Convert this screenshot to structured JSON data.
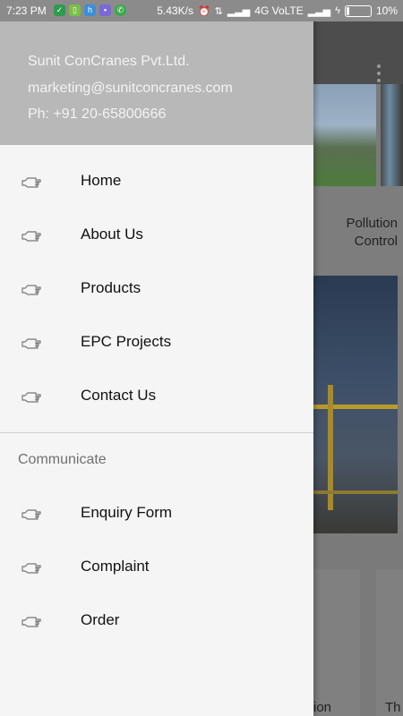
{
  "status_bar": {
    "time": "7:23 PM",
    "speed": "5.43K/s",
    "network": "4G VoLTE",
    "battery": "10%",
    "battery_level": 0.1
  },
  "drawer": {
    "company": "Sunit ConCranes Pvt.Ltd.",
    "email": "marketing@sunitconcranes.com",
    "phone": "Ph: +91 20-65800666",
    "items": [
      {
        "label": "Home",
        "icon": "pointing-hand-icon"
      },
      {
        "label": "About Us",
        "icon": "pointing-hand-icon"
      },
      {
        "label": "Products",
        "icon": "pointing-hand-icon"
      },
      {
        "label": "EPC Projects",
        "icon": "pointing-hand-icon"
      },
      {
        "label": "Contact Us",
        "icon": "pointing-hand-icon"
      }
    ],
    "section_title": "Communicate",
    "items2": [
      {
        "label": "Enquiry Form",
        "icon": "pointing-hand-icon"
      },
      {
        "label": "Complaint",
        "icon": "pointing-hand-icon"
      },
      {
        "label": "Order",
        "icon": "pointing-hand-icon"
      }
    ]
  },
  "background": {
    "card_text_line1": "Pollution",
    "card_text_line2": "Control",
    "bottom_text_1": "ion",
    "bottom_text_2": "Th"
  },
  "colors": {
    "drawer_bg": "#f5f5f5",
    "header_bg": "#b8b8b8",
    "scrim_toolbar": "#4d4d4d"
  }
}
